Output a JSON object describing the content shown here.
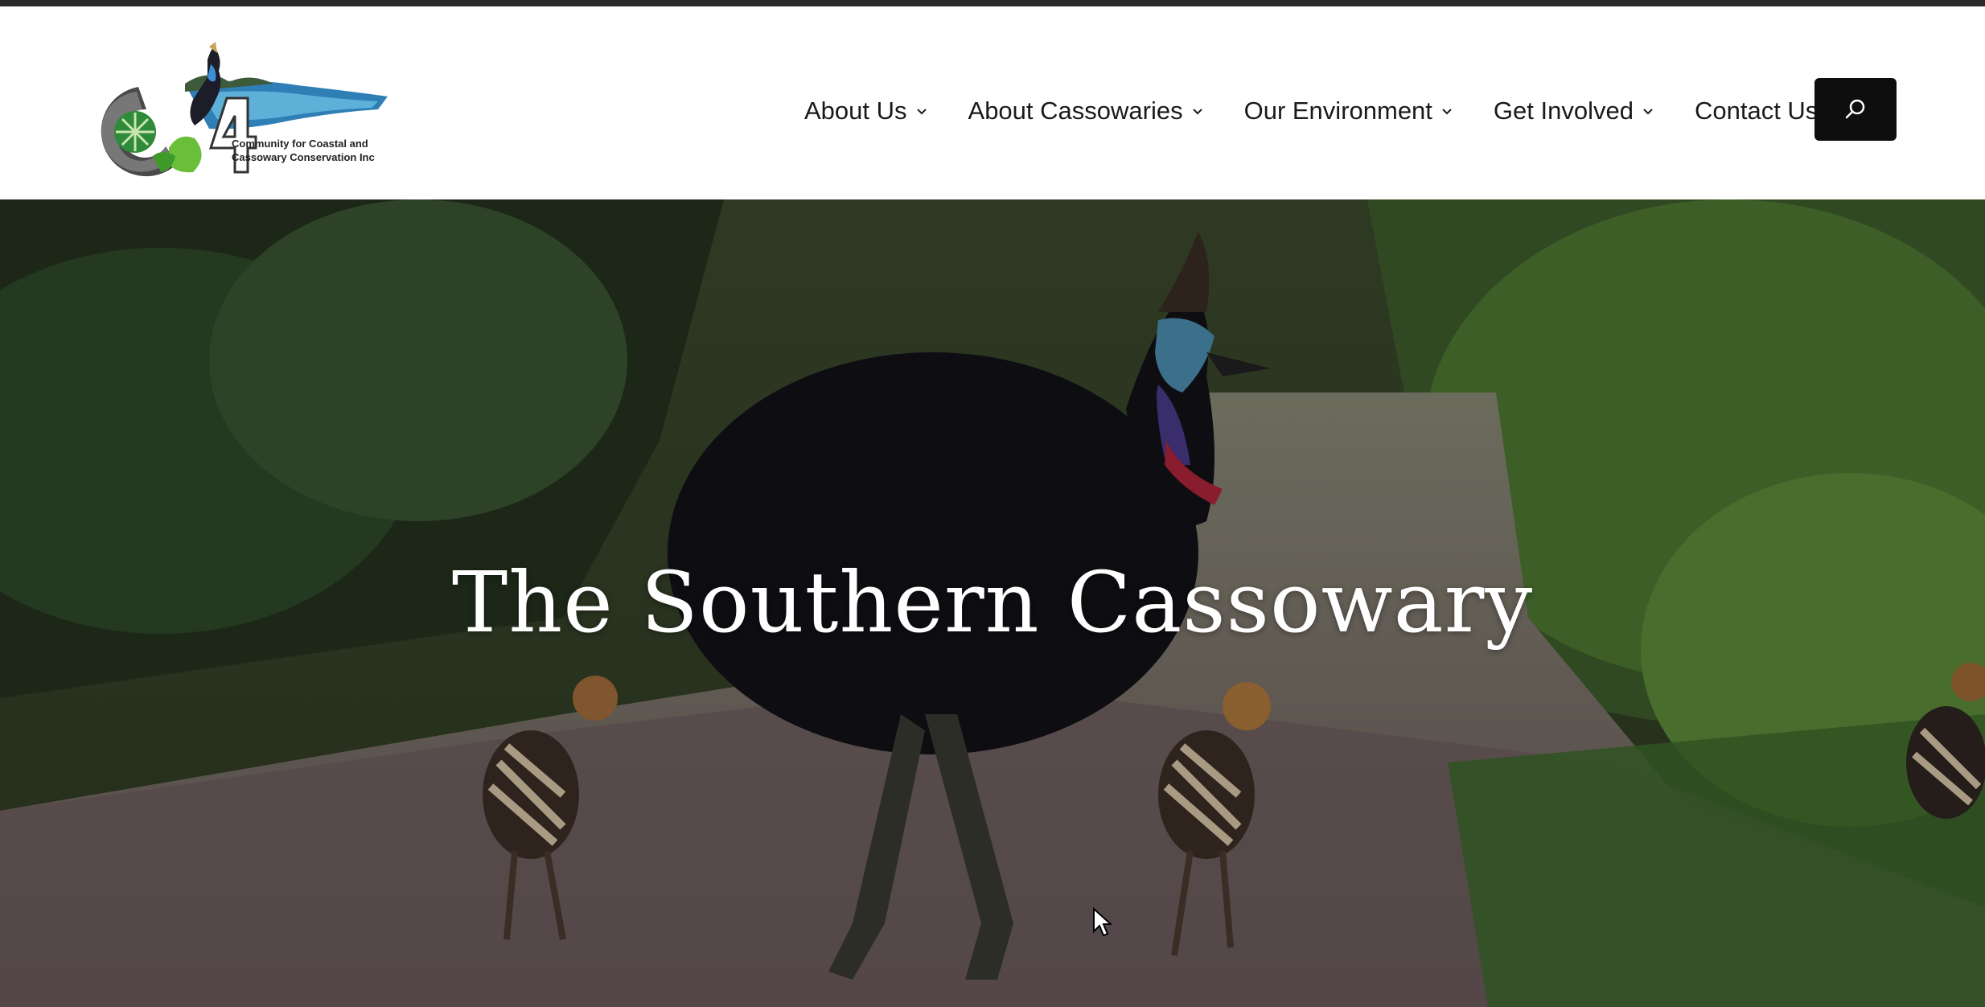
{
  "header": {
    "logo": {
      "mark": "C4",
      "org_name_line1": "Community for  Coastal and",
      "org_name_line2": "Cassowary Conservation Inc",
      "icon": "cassowary-logo"
    },
    "nav": [
      {
        "label": "About Us",
        "has_dropdown": true
      },
      {
        "label": "About Cassowaries",
        "has_dropdown": true
      },
      {
        "label": "Our Environment",
        "has_dropdown": true
      },
      {
        "label": "Get Involved",
        "has_dropdown": true
      },
      {
        "label": "Contact Us",
        "has_dropdown": false
      }
    ],
    "search_icon": "search-icon"
  },
  "hero": {
    "title": "The Southern Cassowary",
    "image": "cassowary adult with chicks on forest path"
  },
  "colors": {
    "topbar": "#2b2b2b",
    "search_button": "#0e0e0e",
    "nav_text": "#1a1a1a",
    "hero_title": "#ffffff"
  }
}
